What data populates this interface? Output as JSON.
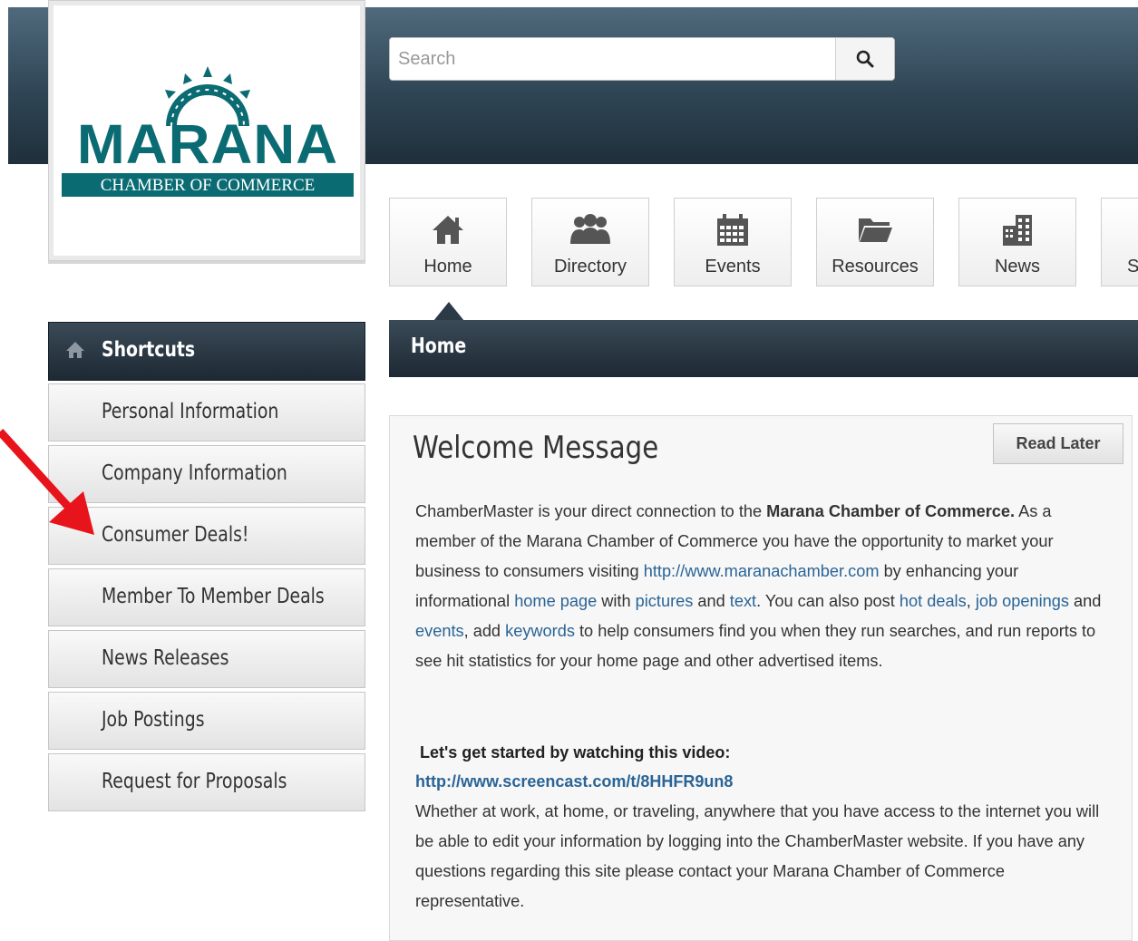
{
  "logo": {
    "word": "MARANA",
    "sub": "CHAMBER OF COMMERCE"
  },
  "search": {
    "placeholder": "Search"
  },
  "nav": {
    "tiles": [
      {
        "label": "Home",
        "icon": "home-icon"
      },
      {
        "label": "Directory",
        "icon": "people-icon"
      },
      {
        "label": "Events",
        "icon": "calendar-icon"
      },
      {
        "label": "Resources",
        "icon": "folder-icon"
      },
      {
        "label": "News",
        "icon": "building-icon"
      },
      {
        "label": "S",
        "icon": "partial-icon"
      }
    ]
  },
  "breadcrumb": {
    "title": "Home"
  },
  "shortcuts": {
    "title": "Shortcuts",
    "items": [
      "Personal Information",
      "Company Information",
      "Consumer Deals!",
      "Member To Member Deals",
      "News Releases",
      "Job Postings",
      "Request for Proposals"
    ]
  },
  "welcome": {
    "title": "Welcome Message",
    "read_later": "Read Later",
    "p1_a": "ChamberMaster is your direct connection to the ",
    "p1_bold": "Marana Chamber of Commerce.",
    "p1_b": "  As a member of the Marana Chamber of Commerce you have the opportunity to market your business to consumers visiting ",
    "link_site": "http://www.maranachamber.com",
    "p1_c": " by enhancing your informational ",
    "link_home": "home page",
    "p1_d": " with ",
    "link_pictures": "pictures",
    "p1_e": " and ",
    "link_text": "text",
    "p1_f": ".  You can also post ",
    "link_hotdeals": "hot deals",
    "p1_g": ", ",
    "link_jobs": "job openings",
    "p1_h": " and ",
    "link_events": "events",
    "p1_i": ", add ",
    "link_keywords": "keywords",
    "p1_j": " to help consumers find you when they run searches, and run reports to see hit statistics for your home page and other advertised items.",
    "video_head": "Let's get started by watching this video:",
    "video_link": "http://www.screencast.com/t/8HHFR9un8",
    "p2": "Whether at work, at home, or traveling, anywhere that you have access to the internet you will be able to edit your information by logging into the ChamberMaster website. If you have any questions regarding this site please contact your Marana Chamber of Commerce representative."
  },
  "colors": {
    "header": "#2f4555",
    "brand_teal": "#0b6b73",
    "link": "#2a6496",
    "arrow": "#e8141b"
  }
}
